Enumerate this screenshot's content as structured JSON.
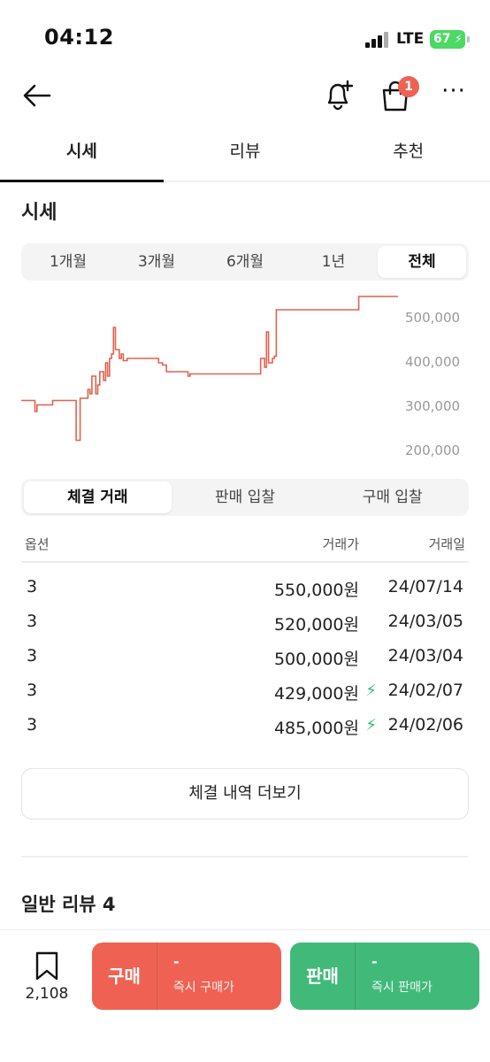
{
  "status_bar": {
    "time": "04:12",
    "network": "LTE",
    "battery": "67"
  },
  "header": {
    "back_icon": "arrow-left-icon",
    "alert_icon": "bell-plus-icon",
    "bag_icon": "shopping-bag-icon",
    "bag_badge": "1",
    "more_icon": "more-horizontal-icon"
  },
  "tabs": [
    {
      "label": "시세",
      "active": true
    },
    {
      "label": "리뷰",
      "active": false
    },
    {
      "label": "추천",
      "active": false
    }
  ],
  "price_section": {
    "title": "시세"
  },
  "period_tabs": [
    {
      "label": "1개월",
      "active": false
    },
    {
      "label": "3개월",
      "active": false
    },
    {
      "label": "6개월",
      "active": false
    },
    {
      "label": "1년",
      "active": false
    },
    {
      "label": "전체",
      "active": true
    }
  ],
  "chart_data": {
    "type": "line",
    "series": [
      {
        "color": "#e0624f",
        "x": [
          0,
          3,
          3.5,
          4,
          6,
          8,
          13,
          14,
          14.5,
          15,
          17,
          17.5,
          18,
          19,
          19.5,
          20,
          21,
          21.5,
          22,
          22.5,
          23,
          23.5,
          24,
          25,
          25.5,
          26,
          27,
          34,
          35,
          36,
          37,
          42,
          42.5,
          43,
          48,
          60,
          61,
          62,
          62.5,
          63,
          64,
          64.5,
          65,
          74,
          75,
          76,
          82,
          86,
          96
        ],
        "y": [
          315000,
          315000,
          290000,
          305000,
          305000,
          315000,
          315000,
          225000,
          225000,
          320000,
          340000,
          330000,
          370000,
          330000,
          350000,
          380000,
          360000,
          400000,
          370000,
          410000,
          420000,
          480000,
          430000,
          410000,
          420000,
          405000,
          410000,
          410000,
          400000,
          395000,
          380000,
          380000,
          370000,
          375000,
          375000,
          375000,
          410000,
          390000,
          470000,
          400000,
          410000,
          415000,
          520000,
          520000,
          520000,
          520000,
          520000,
          550000,
          550000
        ]
      }
    ],
    "ylim": [
      180000,
      560000
    ],
    "y_ticks": [
      "500,000",
      "400,000",
      "300,000",
      "200,000"
    ],
    "y_tick_values": [
      500000,
      400000,
      300000,
      200000
    ],
    "grid": false
  },
  "trade_tabs": [
    {
      "label": "체결 거래",
      "active": true
    },
    {
      "label": "판매 입찰",
      "active": false
    },
    {
      "label": "구매 입찰",
      "active": false
    }
  ],
  "table": {
    "headers": {
      "option": "옵션",
      "price": "거래가",
      "date": "거래일"
    },
    "rows": [
      {
        "option": "3",
        "price": "550,000원",
        "date": "24/07/14",
        "fast": false
      },
      {
        "option": "3",
        "price": "520,000원",
        "date": "24/03/05",
        "fast": false
      },
      {
        "option": "3",
        "price": "500,000원",
        "date": "24/03/04",
        "fast": false
      },
      {
        "option": "3",
        "price": "429,000원",
        "date": "24/02/07",
        "fast": true
      },
      {
        "option": "3",
        "price": "485,000원",
        "date": "24/02/06",
        "fast": true
      }
    ]
  },
  "more_button": "체결 내역 더보기",
  "review_title": "일반 리뷰 4",
  "bottom_bar": {
    "bookmark_count": "2,108",
    "buy": {
      "label": "구매",
      "price": "-",
      "sub": "즉시 구매가"
    },
    "sell": {
      "label": "판매",
      "price": "-",
      "sub": "즉시 판매가"
    }
  },
  "colors": {
    "buy": "#ef6253",
    "sell": "#41b979",
    "badge": "#ef6253",
    "fast_icon": "#2fbc6e",
    "chart_line": "#e0624f"
  }
}
